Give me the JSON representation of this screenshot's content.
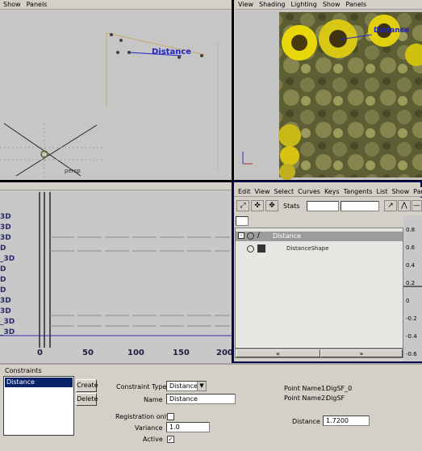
{
  "top_left_panel": {
    "menu": [
      "Show",
      "Panels"
    ],
    "distance_label": "Distance",
    "locator_label": "persp"
  },
  "top_right_panel": {
    "menu": [
      "View",
      "Shading",
      "Lighting",
      "Show",
      "Panels"
    ],
    "distance_label": "Distance"
  },
  "graph_panel": {
    "row_labels": [
      "3D",
      "3D",
      "3D",
      "D",
      "_3D",
      "D",
      "D",
      "D",
      "3D",
      "3D",
      "_3D",
      "_3D"
    ],
    "x_ticks": [
      "0",
      "50",
      "100",
      "150",
      "200"
    ]
  },
  "outliner_panel": {
    "menu": [
      "Edit",
      "View",
      "Select",
      "Curves",
      "Keys",
      "Tangents",
      "List",
      "Show",
      "Panels"
    ],
    "stats_label": "Stats",
    "tree": [
      {
        "label": "Distance",
        "selected": true
      },
      {
        "label": "DistanceShape",
        "selected": false
      }
    ],
    "y_ticks": [
      "0.8",
      "0.6",
      "0.4",
      "0.2",
      "0",
      "-0.2",
      "-0.4",
      "-0.6"
    ],
    "scroll_left": "«",
    "scroll_right": "»"
  },
  "constraints": {
    "header": "Constraints",
    "list": [
      "Distance"
    ],
    "create_label": "Create",
    "delete_label": "Delete",
    "constraint_type_label": "Constraint Type",
    "constraint_type_value": "Distance",
    "name_label": "Name",
    "name_value": "Distance",
    "registration_label": "Registration only",
    "variance_label": "Variance",
    "variance_value": "1.0",
    "active_label": "Active",
    "active_check": "✓",
    "point1_label": "Point Name1:",
    "point1_value": "DigSF_0",
    "point2_label": "Point Name2:",
    "point2_value": "DigSF",
    "distance_label": "Distance",
    "distance_value": "1.7200"
  }
}
